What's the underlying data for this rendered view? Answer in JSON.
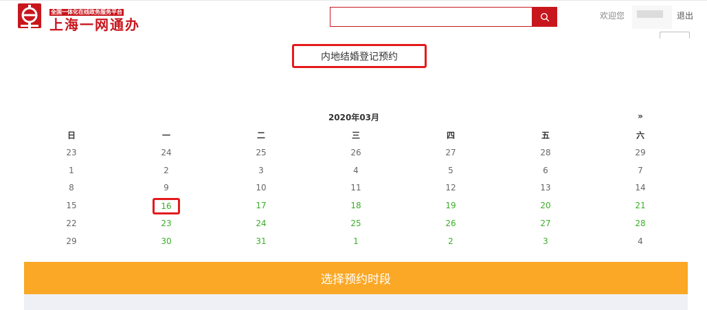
{
  "header": {
    "logo_tag": "全国一体化在线政务服务平台",
    "logo_name": "上海一网通办",
    "search": {
      "placeholder": "",
      "value": ""
    },
    "welcome_text": "欢迎您",
    "logout_label": "退出"
  },
  "title": "内地结婚登记预约",
  "calendar": {
    "month_label": "2020年03月",
    "next_label": "»",
    "weekdays": [
      "日",
      "一",
      "二",
      "三",
      "四",
      "五",
      "六"
    ],
    "weeks": [
      [
        "23",
        "24",
        "25",
        "26",
        "27",
        "28",
        "29"
      ],
      [
        "1",
        "2",
        "3",
        "4",
        "5",
        "6",
        "7"
      ],
      [
        "8",
        "9",
        "10",
        "11",
        "12",
        "13",
        "14"
      ],
      [
        "15",
        "16",
        "17",
        "18",
        "19",
        "20",
        "21"
      ],
      [
        "22",
        "23",
        "24",
        "25",
        "26",
        "27",
        "28"
      ],
      [
        "29",
        "30",
        "31",
        "1",
        "2",
        "3",
        "4"
      ]
    ],
    "selected": "16"
  },
  "action_bar_label": "选择预约时段",
  "colors": {
    "brand_red": "#c8161d",
    "highlight_red": "#e3191b",
    "available_green": "#3aae27",
    "bar_orange": "#fba826"
  }
}
